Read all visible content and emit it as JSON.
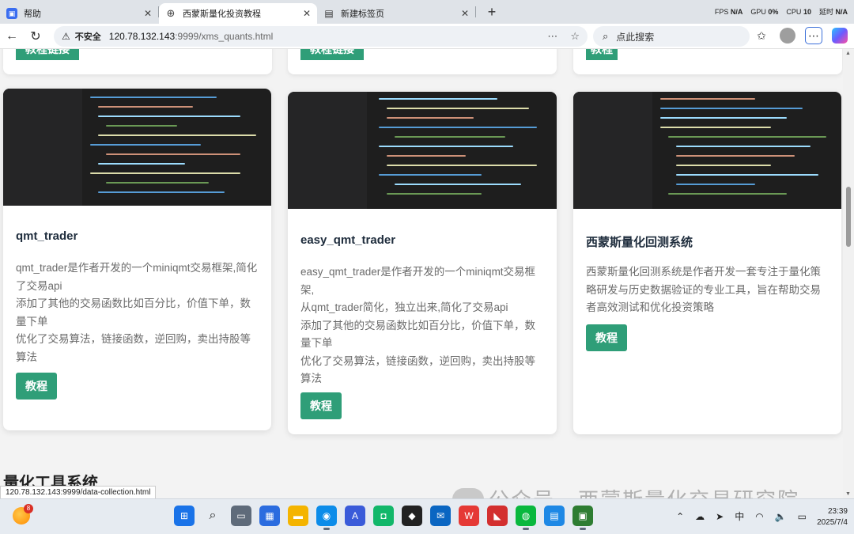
{
  "browser": {
    "tabs": [
      {
        "title": "帮助",
        "favicon": "help-app-icon",
        "color": "#3a6df0",
        "active": false
      },
      {
        "title": "西蒙斯量化投资教程",
        "favicon": "globe-icon",
        "color": "#666666",
        "active": true
      },
      {
        "title": "新建标签页",
        "favicon": "newtab-icon",
        "color": "#444444",
        "active": false
      }
    ],
    "sys": {
      "fps": "FPS",
      "fps_val": "N/A",
      "gpu": "GPU",
      "gpu_val": "0%",
      "cpu": "CPU",
      "cpu_val": "10",
      "latency": "延时",
      "latency_val": "N/A"
    },
    "address": {
      "warning": "不安全",
      "host": "120.78.132.143",
      "path": ":9999/xms_quants.html"
    },
    "search_placeholder": "点此搜索"
  },
  "top_cards": [
    {
      "button": "教程链接"
    },
    {
      "button": "教程链接"
    },
    {
      "button": "教程"
    }
  ],
  "cards": [
    {
      "title": "qmt_trader",
      "desc": [
        "qmt_trader是作者开发的一个miniqmt交易框架,简化了交易api",
        "添加了其他的交易函数比如百分比，价值下单，数量下单",
        "优化了交易算法，链接函数，逆回购，卖出持股等算法"
      ],
      "button": "教程"
    },
    {
      "title": "easy_qmt_trader",
      "desc": [
        "easy_qmt_trader是作者开发的一个miniqmt交易框架,",
        "从qmt_trader简化，独立出来,简化了交易api",
        "添加了其他的交易函数比如百分比，价值下单，数量下单",
        "优化了交易算法，链接函数，逆回购，卖出持股等算法"
      ],
      "button": "教程"
    },
    {
      "title": "西蒙斯量化回测系统",
      "desc": [
        "西蒙斯量化回测系统是作者开发一套专注于量化策略研发与历史数据验证的专业工具，旨在帮助交易者高效测试和优化投资策略"
      ],
      "button": "教程"
    }
  ],
  "section_title": "量化工具系统",
  "status_url": "120.78.132.143:9999/data-collection.html",
  "watermark": "公众号 · 西蒙斯量化交易研究院",
  "taskbar": {
    "badge": "8",
    "ime": "中",
    "time": "23:39",
    "date": "2025/7/4"
  },
  "colors": {
    "accent": "#2f9e78",
    "title": "#1f2d3d",
    "text": "#6b6b6b"
  }
}
